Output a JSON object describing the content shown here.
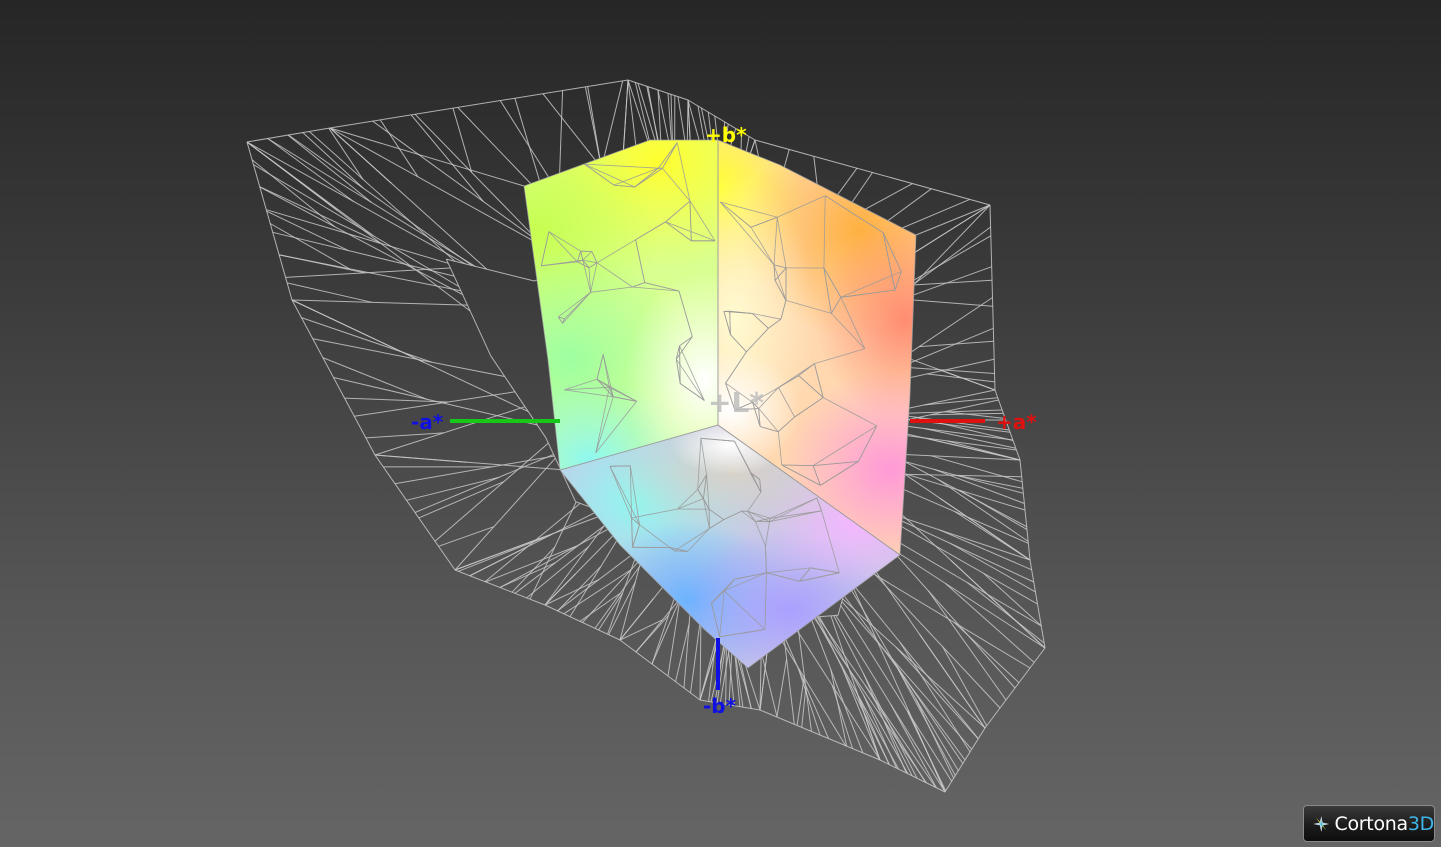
{
  "axes": {
    "plus_b": "+b*",
    "minus_b": "-b*",
    "plus_a": "+a*",
    "minus_a": "-a*",
    "plus_l": "+L*"
  },
  "colors": {
    "plus_b_axis": "#ffff00",
    "minus_b_axis": "#1010e0",
    "plus_a_axis": "#e01010",
    "minus_a_axis": "#18c818",
    "plus_l_axis": "#bdbdbd",
    "wireframe": "#c8c8c8",
    "logo_accent": "#3fb5e8"
  },
  "badge": {
    "brand": "Cortona",
    "brand_suffix": "3D"
  }
}
